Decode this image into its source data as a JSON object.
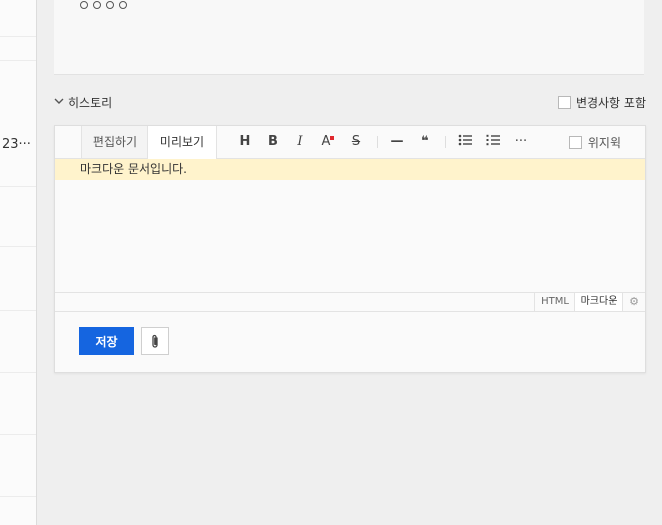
{
  "left_column": {
    "peek_text": "23···"
  },
  "top_card": {
    "circle_count": 4
  },
  "history": {
    "label": "히스토리",
    "include_changes_label": "변경사항 포함"
  },
  "editor": {
    "tabs": {
      "edit": "편집하기",
      "preview": "미리보기"
    },
    "toolbar": {
      "heading": "H",
      "bold": "B",
      "italic": "I",
      "font_color": "A",
      "strikethrough": "S",
      "horizontal_rule": "—",
      "quote": "❝",
      "bullet_list": "☰",
      "numbered_list": "☰",
      "more": "···",
      "watermark_label": "위지윅"
    },
    "notice": "마크다운 문서입니다.",
    "modes": {
      "html": "HTML",
      "markdown": "마크다운",
      "settings": "⚙"
    }
  },
  "actions": {
    "save_label": "저장",
    "attach_icon": "📎"
  },
  "colors": {
    "accent": "#1565e0",
    "notice_bg": "#fff3cc",
    "font_color_marker": "#e0282e"
  }
}
